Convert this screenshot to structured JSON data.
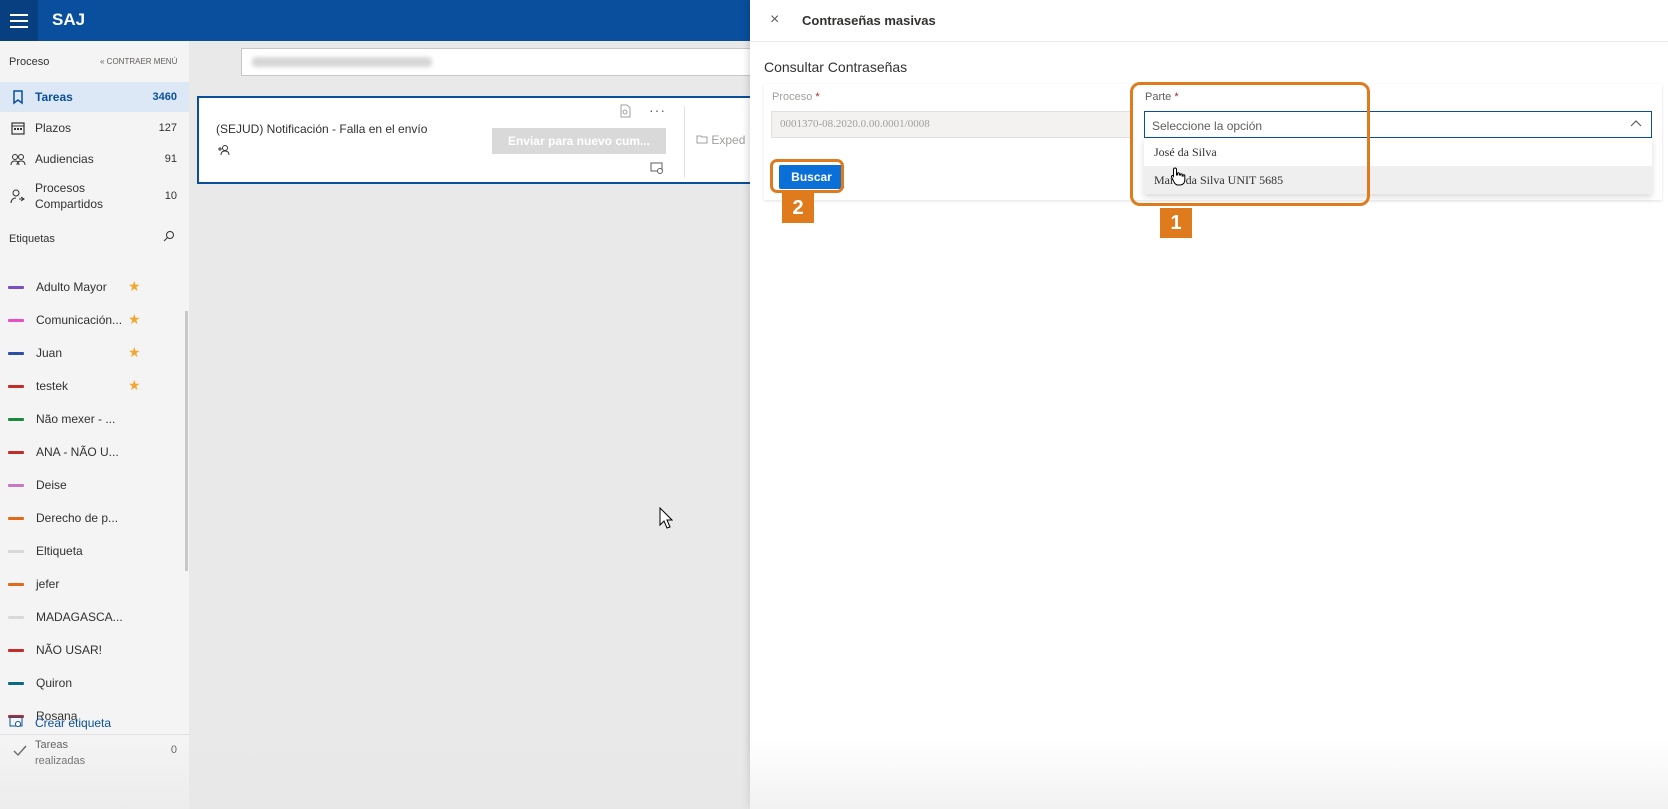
{
  "app": {
    "title": "SAJ"
  },
  "sidebar": {
    "process_header": "Proceso",
    "collapse_label": "CONTRAER MENÚ",
    "nav": [
      {
        "label": "Tareas",
        "count": "3460"
      },
      {
        "label": "Plazos",
        "count": "127"
      },
      {
        "label": "Audiencias",
        "count": "91"
      },
      {
        "label": "Procesos Compartidos",
        "count": "10"
      }
    ],
    "tags_header": "Etiquetas",
    "tags": [
      {
        "name": "Adulto Mayor",
        "color": "#7b4fbf",
        "starred": true
      },
      {
        "name": "Comunicación...",
        "color": "#e84fc3",
        "starred": true
      },
      {
        "name": "Juan",
        "color": "#2a4fa8",
        "starred": true
      },
      {
        "name": "testek",
        "color": "#c42b2b",
        "starred": true
      },
      {
        "name": "Não mexer - ...",
        "color": "#1a8a3a",
        "starred": false
      },
      {
        "name": "ANA - NÃO U...",
        "color": "#c42b2b",
        "starred": false
      },
      {
        "name": "Deise",
        "color": "#c478c0",
        "starred": false
      },
      {
        "name": "Derecho de p...",
        "color": "#e06a1a",
        "starred": false
      },
      {
        "name": "Eltiqueta",
        "color": "#d8d8d8",
        "starred": false
      },
      {
        "name": "jefer",
        "color": "#e06a1a",
        "starred": false
      },
      {
        "name": "MADAGASCA...",
        "color": "#d8d8d8",
        "starred": false
      },
      {
        "name": "NÃO USAR!",
        "color": "#c42b2b",
        "starred": false
      },
      {
        "name": "Quiron",
        "color": "#0a6a80",
        "starred": false
      },
      {
        "name": "Rosana",
        "color": "#c42b2b",
        "starred": false
      }
    ],
    "create_tag": "Crear etiqueta",
    "done": {
      "label": "Tareas realizadas",
      "count": "0"
    }
  },
  "task_card": {
    "title": "(SEJUD) Notificación - Falla en el envío",
    "action_button": "Enviar para nuevo cum...",
    "folder_label": "Exped",
    "more": "···"
  },
  "panel": {
    "close": "×",
    "title": "Contraseñas masivas",
    "section": "Consultar Contraseñas",
    "proceso_label": "Proceso",
    "proceso_value": "0001370-08.2020.0.00.0001/0008",
    "parte_label": "Parte",
    "required_mark": "*",
    "parte_placeholder": "Seleccione la opción",
    "options": [
      "José da Silva",
      "Maria da Silva UNIT 5685"
    ],
    "buscar": "Buscar"
  },
  "annotations": {
    "step1": "1",
    "step2": "2",
    "color": "#e07b1d"
  }
}
